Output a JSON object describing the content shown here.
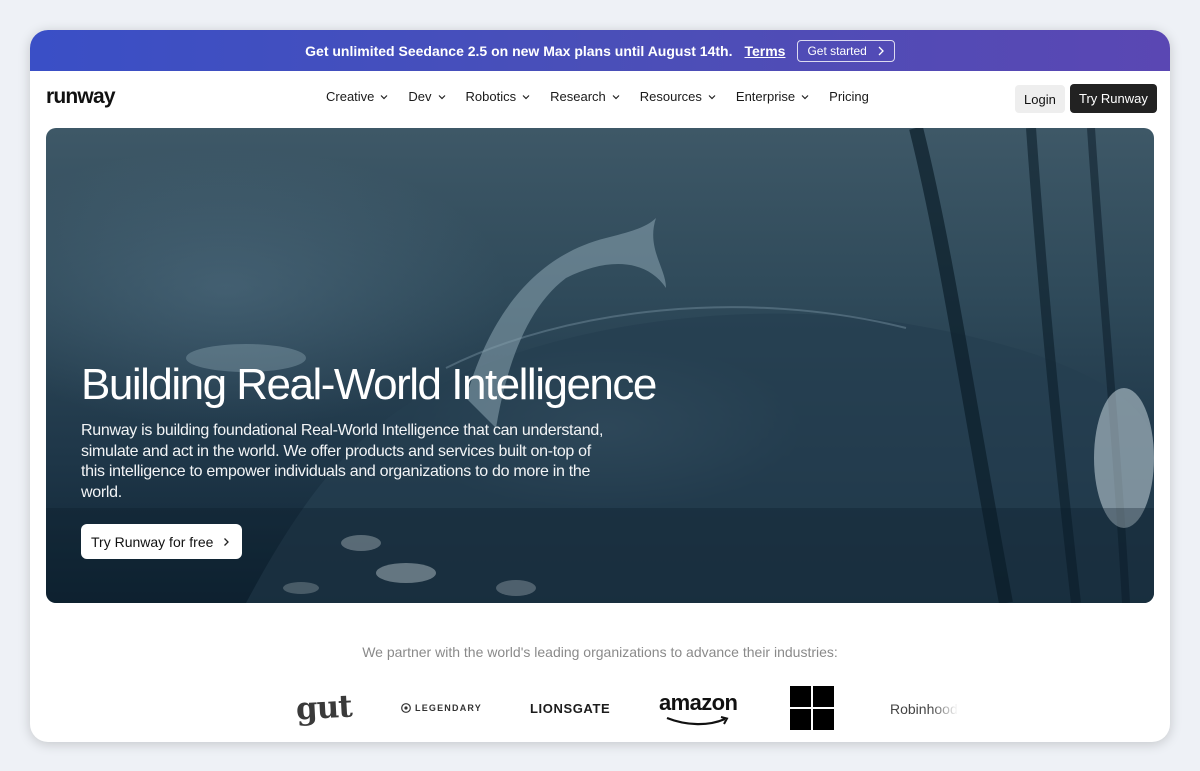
{
  "announcement": {
    "text": "Get unlimited Seedance 2.5 on new Max plans until August 14th.",
    "terms": "Terms",
    "cta": "Get started"
  },
  "nav": {
    "logo": "runway",
    "menu": [
      {
        "label": "Creative",
        "has_dropdown": true
      },
      {
        "label": "Dev",
        "has_dropdown": true
      },
      {
        "label": "Robotics",
        "has_dropdown": true
      },
      {
        "label": "Research",
        "has_dropdown": true
      },
      {
        "label": "Resources",
        "has_dropdown": true
      },
      {
        "label": "Enterprise",
        "has_dropdown": true
      },
      {
        "label": "Pricing",
        "has_dropdown": false
      }
    ],
    "login": "Login",
    "try": "Try Runway"
  },
  "hero": {
    "title": "Building Real-World Intelligence",
    "description": "Runway is building foundational Real-World Intelligence that can understand, simulate and act in the world. We offer products and services built on-top of this intelligence to empower individuals and organizations to do more in the world.",
    "button": "Try Runway for free"
  },
  "partners": {
    "text": "We partner with the world's leading organizations to advance their industries:",
    "logos": {
      "gut": "gut",
      "legendary": "LEGENDARY",
      "lionsgate": "LIONSGATE",
      "amazon": "amazon",
      "microsoft": "microsoft-logo",
      "robinhood": "Robinhood"
    }
  },
  "colors": {
    "announce_bar": "#3a4fc6",
    "primary_button": "#222222",
    "hero_dark": "#1e3648"
  }
}
